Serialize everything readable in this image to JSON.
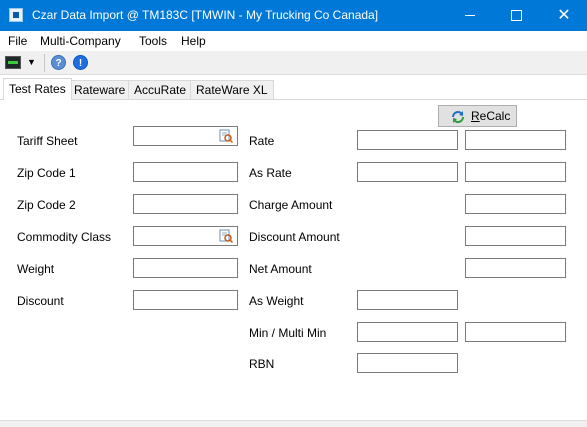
{
  "window": {
    "title": "Czar Data Import @ TM183C [TMWIN - My Trucking Co Canada]"
  },
  "menu": {
    "items": [
      "File",
      "Multi-Company",
      "Tools",
      "Help"
    ]
  },
  "toolbar": {
    "icons": [
      "monitor-icon",
      "dropdown-arrow-icon",
      "help-icon",
      "info-icon"
    ],
    "help_glyph": "?",
    "info_glyph": "!",
    "dropdown_glyph": "▼"
  },
  "tabs": [
    "Test Rates",
    "Rateware",
    "AccuRate",
    "RateWare XL"
  ],
  "active_tab": "Test Rates",
  "recalc": {
    "label_accel": "R",
    "label_rest": "eCalc"
  },
  "left_fields": [
    {
      "label": "Tariff Sheet",
      "value": "",
      "lookup": true
    },
    {
      "label": "Zip Code 1",
      "value": "",
      "lookup": false
    },
    {
      "label": "Zip Code 2",
      "value": "",
      "lookup": false
    },
    {
      "label": "Commodity Class",
      "value": "",
      "lookup": true
    },
    {
      "label": "Weight",
      "value": "",
      "lookup": false
    },
    {
      "label": "Discount",
      "value": "",
      "lookup": false
    }
  ],
  "right_fields": [
    {
      "label": "Rate",
      "value1": "",
      "value2": ""
    },
    {
      "label": "As Rate",
      "value1": "",
      "value2": ""
    },
    {
      "label": "Charge Amount",
      "value2": ""
    },
    {
      "label": "Discount Amount",
      "value2": ""
    },
    {
      "label": "Net Amount",
      "value2": ""
    },
    {
      "label": "As Weight",
      "value1": ""
    },
    {
      "label": "Min / Multi Min",
      "value1": "",
      "value2": ""
    },
    {
      "label": "RBN",
      "value1": ""
    }
  ],
  "colors": {
    "titlebar": "#0078d7",
    "field_border": "#7a7a7a",
    "button_face": "#e1e1e1"
  }
}
